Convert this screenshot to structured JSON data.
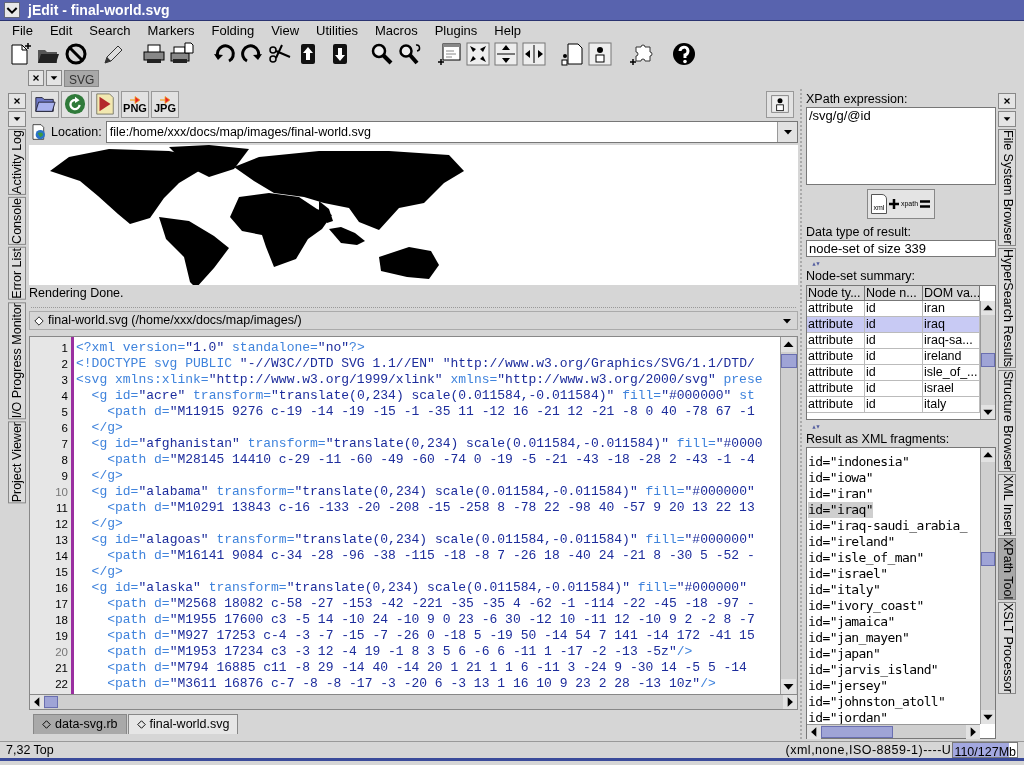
{
  "window": {
    "title": "jEdit - final-world.svg"
  },
  "menu": [
    "File",
    "Edit",
    "Search",
    "Markers",
    "Folding",
    "View",
    "Utilities",
    "Macros",
    "Plugins",
    "Help"
  ],
  "top_dock": {
    "tabs": [
      {
        "label": "SVG",
        "selected": true
      }
    ]
  },
  "left_dock": {
    "tabs": [
      {
        "label": "Activity Log",
        "selected": false
      },
      {
        "label": "Console",
        "selected": false
      },
      {
        "label": "Error List",
        "selected": false
      },
      {
        "label": "I/O Progress Monitor",
        "selected": false
      },
      {
        "label": "Project Viewer",
        "selected": false
      }
    ]
  },
  "svg_viewer": {
    "export_buttons": [
      "PNG",
      "JPG"
    ],
    "location_label": "Location:",
    "location": "file:/home/xxx/docs/map/images/final-world.svg",
    "status": "Rendering Done."
  },
  "editor": {
    "header": "final-world.svg (/home/xxx/docs/map/images/)",
    "line_numbers": [
      "1",
      "2",
      "3",
      "4",
      "5",
      "6",
      "7",
      "8",
      "9",
      "10",
      "11",
      "12",
      "13",
      "14",
      "15",
      "16",
      "17",
      "18",
      "19",
      "20",
      "21",
      "22"
    ],
    "lines": [
      "<?xml version=\"1.0\" standalone=\"no\"?>",
      "<!DOCTYPE svg PUBLIC \"-//W3C//DTD SVG 1.1//EN\" \"http://www.w3.org/Graphics/SVG/1.1/DTD/",
      "<svg xmlns:xlink=\"http://www.w3.org/1999/xlink\" xmlns=\"http://www.w3.org/2000/svg\" prese",
      "  <g id=\"acre\" transform=\"translate(0,234) scale(0.011584,-0.011584)\" fill=\"#000000\" st",
      "    <path d=\"M11915 9276 c-19 -14 -19 -15 -1 -35 11 -12 16 -21 12 -21 -8 0 40 -78 67 -1",
      "  </g>",
      "  <g id=\"afghanistan\" transform=\"translate(0,234) scale(0.011584,-0.011584)\" fill=\"#0000",
      "    <path d=\"M28145 14410 c-29 -11 -60 -49 -60 -74 0 -19 -5 -21 -43 -18 -28 2 -43 -1 -4",
      "  </g>",
      "  <g id=\"alabama\" transform=\"translate(0,234) scale(0.011584,-0.011584)\" fill=\"#000000\"",
      "    <path d=\"M10291 13843 c-16 -133 -20 -208 -15 -258 8 -78 22 -98 40 -57 9 20 13 22 13",
      "  </g>",
      "  <g id=\"alagoas\" transform=\"translate(0,234) scale(0.011584,-0.011584)\" fill=\"#000000\"",
      "    <path d=\"M16141 9084 c-34 -28 -96 -38 -115 -18 -8 7 -26 18 -40 24 -21 8 -30 5 -52 -",
      "  </g>",
      "  <g id=\"alaska\" transform=\"translate(0,234) scale(0.011584,-0.011584)\" fill=\"#000000\"",
      "    <path d=\"M2568 18082 c-58 -27 -153 -42 -221 -35 -35 4 -62 -1 -114 -22 -45 -18 -97 -",
      "    <path d=\"M1955 17600 c3 -5 14 -10 24 -10 9 0 23 -6 30 -12 10 -11 12 -10 9 2 -2 8 -7",
      "    <path d=\"M927 17253 c-4 -3 -7 -15 -7 -26 0 -18 5 -19 50 -14 54 7 141 -14 172 -41 15",
      "    <path d=\"M1953 17234 c3 -3 12 -4 19 -1 8 3 5 6 -6 6 -11 1 -17 -2 -13 -5z\"/>",
      "    <path d=\"M794 16885 c11 -8 29 -14 40 -14 20 1 21 1 1 6 -11 3 -24 9 -30 14 -5 5 -14",
      "    <path d=\"M3611 16876 c-7 -8 -8 -17 -3 -20 6 -3 13 1 16 10 9 23 2 28 -13 10z\"/>"
    ]
  },
  "buffer_tabs": [
    {
      "label": "data-svg.rb",
      "selected": false
    },
    {
      "label": "final-world.svg",
      "selected": true
    }
  ],
  "xpath_tool": {
    "expression_label": "XPath expression:",
    "expression": "/svg/g/@id",
    "evaluate_button": [
      "xml",
      "xpath"
    ],
    "data_type_label": "Data type of result:",
    "data_type": "node-set of size 339",
    "summary_label": "Node-set summary:",
    "columns": [
      "Node ty...",
      "Node n...",
      "DOM va..."
    ],
    "rows": [
      {
        "cells": [
          "attribute",
          "id",
          "iran"
        ],
        "selected": false
      },
      {
        "cells": [
          "attribute",
          "id",
          "iraq"
        ],
        "selected": true
      },
      {
        "cells": [
          "attribute",
          "id",
          "iraq-sa..."
        ],
        "selected": false
      },
      {
        "cells": [
          "attribute",
          "id",
          "ireland"
        ],
        "selected": false
      },
      {
        "cells": [
          "attribute",
          "id",
          "isle_of_..."
        ],
        "selected": false
      },
      {
        "cells": [
          "attribute",
          "id",
          "israel"
        ],
        "selected": false
      },
      {
        "cells": [
          "attribute",
          "id",
          "italy"
        ],
        "selected": false
      }
    ],
    "fragments_label": "Result as XML fragments:",
    "fragments": [
      {
        "text": "id=\"indonesia\"",
        "selected": false
      },
      {
        "text": "id=\"iowa\"",
        "selected": false
      },
      {
        "text": "id=\"iran\"",
        "selected": false
      },
      {
        "text": "id=\"iraq\"",
        "selected": true
      },
      {
        "text": "id=\"iraq-saudi_arabia_",
        "selected": false
      },
      {
        "text": "id=\"ireland\"",
        "selected": false
      },
      {
        "text": "id=\"isle_of_man\"",
        "selected": false
      },
      {
        "text": "id=\"israel\"",
        "selected": false
      },
      {
        "text": "id=\"italy\"",
        "selected": false
      },
      {
        "text": "id=\"ivory_coast\"",
        "selected": false
      },
      {
        "text": "id=\"jamaica\"",
        "selected": false
      },
      {
        "text": "id=\"jan_mayen\"",
        "selected": false
      },
      {
        "text": "id=\"japan\"",
        "selected": false
      },
      {
        "text": "id=\"jarvis_island\"",
        "selected": false
      },
      {
        "text": "id=\"jersey\"",
        "selected": false
      },
      {
        "text": "id=\"johnston_atoll\"",
        "selected": false
      },
      {
        "text": "id=\"jordan\"",
        "selected": false
      }
    ]
  },
  "right_dock": {
    "tabs": [
      {
        "label": "File System Browser",
        "selected": false
      },
      {
        "label": "HyperSearch Results",
        "selected": false
      },
      {
        "label": "Structure Browser",
        "selected": false
      },
      {
        "label": "XML Insert",
        "selected": false
      },
      {
        "label": "XPath Tool",
        "selected": true
      },
      {
        "label": "XSLT Processor",
        "selected": false
      }
    ]
  },
  "status_bar": {
    "position": "7,32 Top",
    "mode": "(xml,none,ISO-8859-1)----U",
    "memory": "110/127Mb",
    "level": 0.87
  }
}
